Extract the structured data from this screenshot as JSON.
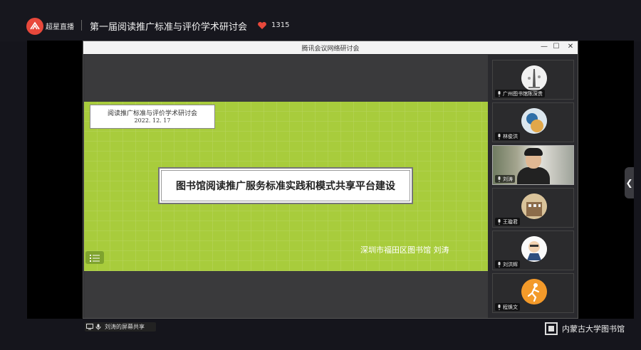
{
  "header": {
    "brand": "超星直播",
    "live_title": "第一届阅读推广标准与评价学术研讨会",
    "like_count": "1315"
  },
  "window": {
    "title": "腾讯会议网络研讨会",
    "controls": {
      "minimize": "—",
      "maximize": "☐",
      "close": "✕"
    }
  },
  "slide": {
    "conference_name": "阅读推广标准与评价学术研讨会",
    "conference_date": "2022. 12. 17",
    "talk_title": "图书馆阅读推广服务标准实践和模式共享平台建设",
    "speaker_line": "深圳市福田区图书馆  刘涛"
  },
  "share_label": "刘涛的屏幕共享",
  "participants": [
    {
      "name": "广州图书馆陈深贵",
      "avatar": "tower-avatar"
    },
    {
      "name": "林俊洪",
      "avatar": "planet-avatar"
    },
    {
      "name": "刘涛",
      "avatar": "camera-video",
      "active": true
    },
    {
      "name": "王璇君",
      "avatar": "building-avatar"
    },
    {
      "name": "刘洪辉",
      "avatar": "cartoon-avatar"
    },
    {
      "name": "程焕文",
      "avatar": "runner-avatar"
    }
  ],
  "footer": {
    "org_name": "内蒙古大学图书馆"
  },
  "colors": {
    "slide_bg": "#a8cc3c",
    "accent": "#e8483b"
  }
}
